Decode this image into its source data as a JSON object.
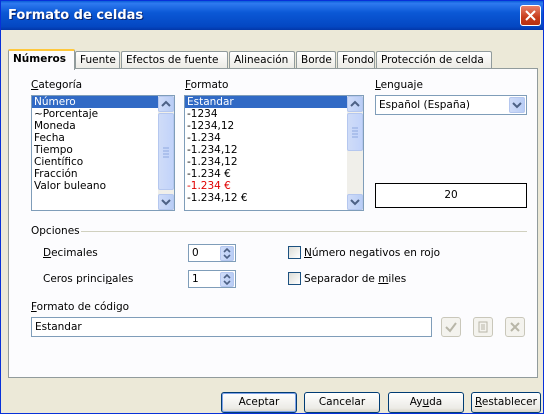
{
  "window": {
    "title": "Formato de celdas"
  },
  "tabs": [
    {
      "label": "Números",
      "active": true
    },
    {
      "label": "Fuente"
    },
    {
      "label": "Efectos de fuente"
    },
    {
      "label": "Alineación"
    },
    {
      "label": "Borde"
    },
    {
      "label": "Fondo"
    },
    {
      "label": "Protección de celda"
    }
  ],
  "categoria": {
    "label": "Categoría",
    "items": [
      "Número",
      "~Porcentaje",
      "Moneda",
      "Fecha",
      "Tiempo",
      "Científico",
      "Fracción",
      "Valor buleano"
    ],
    "selected": "Número"
  },
  "formato": {
    "label": "Formato",
    "items": [
      "Estandar",
      "-1234",
      "-1234,12",
      "-1.234",
      "-1.234,12",
      "-1.234,12",
      "-1.234 €",
      "-1.234 €",
      "-1.234,12 €"
    ],
    "selected": "Estandar",
    "red_items": [
      "-1.234 €"
    ],
    "red_color": "#e00000"
  },
  "lenguaje": {
    "label": "Lenguaje",
    "value": "Español (España)"
  },
  "preview": {
    "value": "20"
  },
  "opciones": {
    "label": "Opciones",
    "decimales_label": "Decimales",
    "decimales_value": "0",
    "ceros_label": "Ceros principales",
    "ceros_value": "1",
    "negativos_label": "Número negativos en rojo",
    "negativos_checked": false,
    "miles_label": "Separador de miles",
    "miles_checked": false
  },
  "codigo": {
    "label": "Formato de código",
    "value": "Estandar"
  },
  "buttons": {
    "aceptar": "Aceptar",
    "cancelar": "Cancelar",
    "ayuda": "Ayuda",
    "restablecer": "Restablecer"
  },
  "colors": {
    "titlebar": "#0b58d6",
    "selection": "#316ac5",
    "tab_highlight": "#ffc83c",
    "dialog_bg": "#ece9d8"
  }
}
